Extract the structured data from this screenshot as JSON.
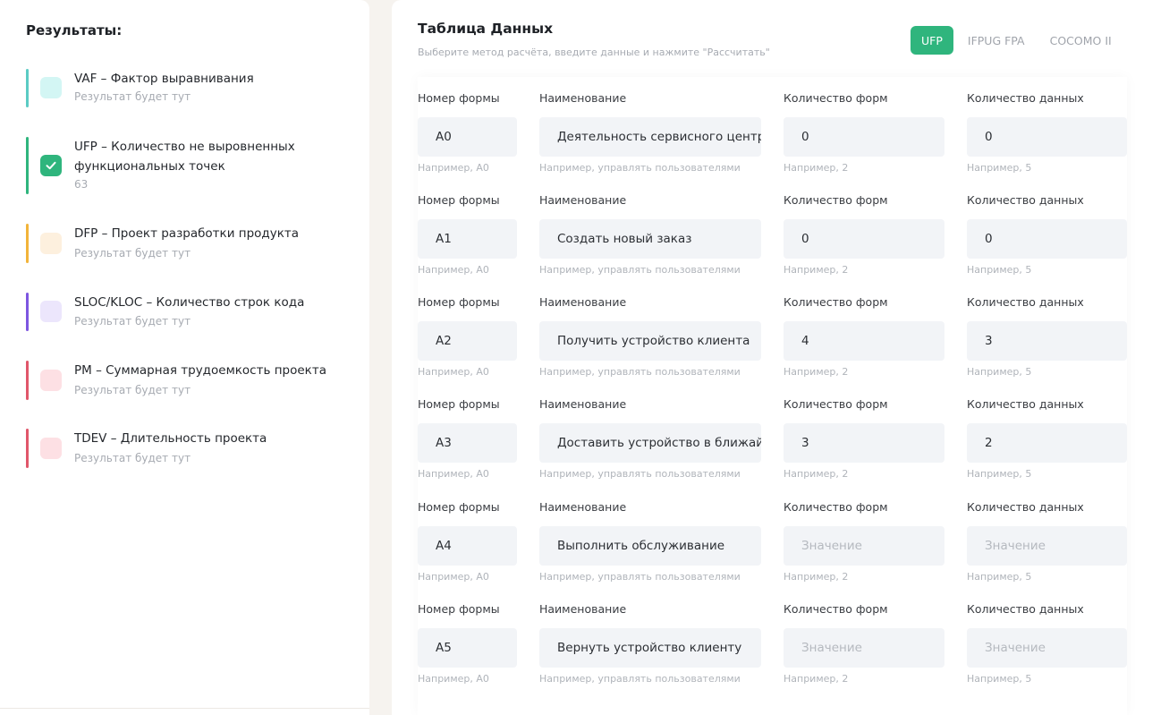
{
  "results": {
    "title": "Результаты:",
    "items": [
      {
        "title": "VAF – Фактор выравнивания",
        "sub": "Результат будет тут",
        "bar": "#5bcbc4",
        "box": "#d3f6f4",
        "checked": false
      },
      {
        "title": "UFP – Количество не выровненных функциональных точек",
        "sub": "63",
        "bar": "#2fb57d",
        "box": "#2fb57d",
        "checked": true
      },
      {
        "title": "DFP – Проект разработки продукта",
        "sub": "Результат будет тут",
        "bar": "#f2b43a",
        "box": "#fdf0de",
        "checked": false
      },
      {
        "title": "SLOC/KLOC – Количество строк кода",
        "sub": "Результат будет тут",
        "bar": "#7d56e0",
        "box": "#ece6fc",
        "checked": false
      },
      {
        "title": "PM – Суммарная трудоемкость проекта",
        "sub": "Результат будет тут",
        "bar": "#e0566a",
        "box": "#fde0e4",
        "checked": false
      },
      {
        "title": "TDEV – Длительность проекта",
        "sub": "Результат будет тут",
        "bar": "#e0566a",
        "box": "#fde0e4",
        "checked": false
      }
    ]
  },
  "table": {
    "title": "Таблица Данных",
    "subtitle": "Выберите метод расчёта, введите данные и нажмите \"Рассчитать\"",
    "methods": [
      "UFP",
      "IFPUG FPA",
      "COCOMO II"
    ],
    "active_method": "UFP",
    "columns": {
      "form_number": "Номер формы",
      "name": "Наименование",
      "form_count": "Количество форм",
      "data_count": "Количество данных"
    },
    "hints": {
      "form_number": "Например, А0",
      "name": "Например, управлять пользователями",
      "form_count": "Например, 2",
      "data_count": "Например, 5"
    },
    "placeholder": "Значение",
    "rows": [
      {
        "form": "А0",
        "name": "Деятельность сервисного центра",
        "form_count": "0",
        "data_count": "0"
      },
      {
        "form": "А1",
        "name": "Создать новый заказ",
        "form_count": "0",
        "data_count": "0"
      },
      {
        "form": "А2",
        "name": "Получить устройство клиента",
        "form_count": "4",
        "data_count": "3"
      },
      {
        "form": "А3",
        "name": "Доставить устройство в ближайший центр",
        "form_count": "3",
        "data_count": "2"
      },
      {
        "form": "А4",
        "name": "Выполнить обслуживание",
        "form_count": "",
        "data_count": ""
      },
      {
        "form": "А5",
        "name": "Вернуть устройство клиенту",
        "form_count": "",
        "data_count": ""
      }
    ]
  }
}
